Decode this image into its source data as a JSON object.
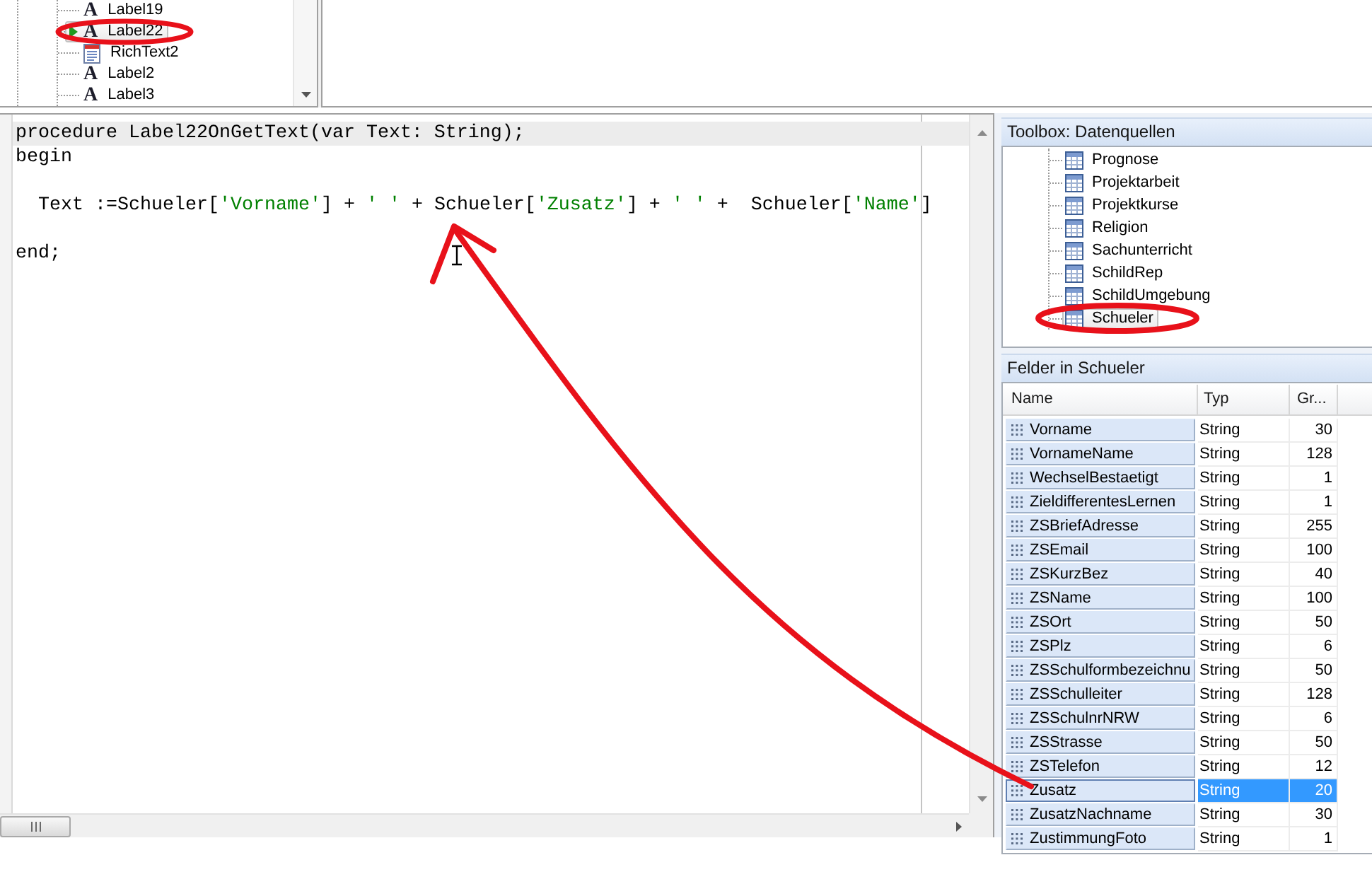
{
  "component_tree": {
    "items": [
      {
        "kind": "label",
        "glyph": "A",
        "label": "Label19",
        "selected": false,
        "has_event": false
      },
      {
        "kind": "label",
        "glyph": "A",
        "label": "Label22",
        "selected": true,
        "has_event": true
      },
      {
        "kind": "richtext",
        "label": "RichText2",
        "selected": false,
        "has_event": false
      },
      {
        "kind": "label",
        "glyph": "A",
        "label": "Label2",
        "selected": false,
        "has_event": false
      },
      {
        "kind": "label",
        "glyph": "A",
        "label": "Label3",
        "selected": false,
        "has_event": false
      }
    ]
  },
  "code_editor": {
    "lines": [
      {
        "kind": "code",
        "current": true,
        "tokens": [
          {
            "kind": "plain",
            "text": "procedure Label22OnGetText(var Text: String);"
          }
        ]
      },
      {
        "kind": "code",
        "current": false,
        "tokens": [
          {
            "kind": "plain",
            "text": "begin"
          }
        ]
      },
      {
        "kind": "blank",
        "current": false
      },
      {
        "kind": "code",
        "current": false,
        "tokens": [
          {
            "kind": "plain",
            "text": "  Text :=Schueler["
          },
          {
            "kind": "string",
            "text": "'Vorname'"
          },
          {
            "kind": "plain",
            "text": "] + "
          },
          {
            "kind": "string",
            "text": "' '"
          },
          {
            "kind": "plain",
            "text": " + Schueler["
          },
          {
            "kind": "string",
            "text": "'Zusatz'"
          },
          {
            "kind": "plain",
            "text": "] + "
          },
          {
            "kind": "string",
            "text": "' '"
          },
          {
            "kind": "plain",
            "text": " +  Schueler["
          },
          {
            "kind": "string",
            "text": "'Name'"
          },
          {
            "kind": "plain",
            "text": "]"
          }
        ]
      },
      {
        "kind": "blank",
        "current": false
      },
      {
        "kind": "code",
        "current": false,
        "tokens": [
          {
            "kind": "plain",
            "text": "end;"
          }
        ]
      }
    ]
  },
  "toolbox": {
    "title": "Toolbox: Datenquellen",
    "items": [
      {
        "label": "Prognose",
        "selected": false
      },
      {
        "label": "Projektarbeit",
        "selected": false
      },
      {
        "label": "Projektkurse",
        "selected": false
      },
      {
        "label": "Religion",
        "selected": false
      },
      {
        "label": "Sachunterricht",
        "selected": false
      },
      {
        "label": "SchildRep",
        "selected": false
      },
      {
        "label": "SchildUmgebung",
        "selected": false
      },
      {
        "label": "Schueler",
        "selected": true
      }
    ]
  },
  "fields": {
    "title": "Felder in Schueler",
    "columns": [
      "Name",
      "Typ",
      "Gr..."
    ],
    "rows": [
      {
        "name": "Vorname",
        "type": "String",
        "size": "30",
        "selected": false
      },
      {
        "name": "VornameName",
        "type": "String",
        "size": "128",
        "selected": false
      },
      {
        "name": "WechselBestaetigt",
        "type": "String",
        "size": "1",
        "selected": false
      },
      {
        "name": "ZieldifferentesLernen",
        "type": "String",
        "size": "1",
        "selected": false
      },
      {
        "name": "ZSBriefAdresse",
        "type": "String",
        "size": "255",
        "selected": false
      },
      {
        "name": "ZSEmail",
        "type": "String",
        "size": "100",
        "selected": false
      },
      {
        "name": "ZSKurzBez",
        "type": "String",
        "size": "40",
        "selected": false
      },
      {
        "name": "ZSName",
        "type": "String",
        "size": "100",
        "selected": false
      },
      {
        "name": "ZSOrt",
        "type": "String",
        "size": "50",
        "selected": false
      },
      {
        "name": "ZSPlz",
        "type": "String",
        "size": "6",
        "selected": false
      },
      {
        "name": "ZSSchulformbezeichnu",
        "type": "String",
        "size": "50",
        "selected": false
      },
      {
        "name": "ZSSchulleiter",
        "type": "String",
        "size": "128",
        "selected": false
      },
      {
        "name": "ZSSchulnrNRW",
        "type": "String",
        "size": "6",
        "selected": false
      },
      {
        "name": "ZSStrasse",
        "type": "String",
        "size": "50",
        "selected": false
      },
      {
        "name": "ZSTelefon",
        "type": "String",
        "size": "12",
        "selected": false
      },
      {
        "name": "Zusatz",
        "type": "String",
        "size": "20",
        "selected": true
      },
      {
        "name": "ZusatzNachname",
        "type": "String",
        "size": "30",
        "selected": false
      },
      {
        "name": "ZustimmungFoto",
        "type": "String",
        "size": "1",
        "selected": false
      }
    ]
  }
}
